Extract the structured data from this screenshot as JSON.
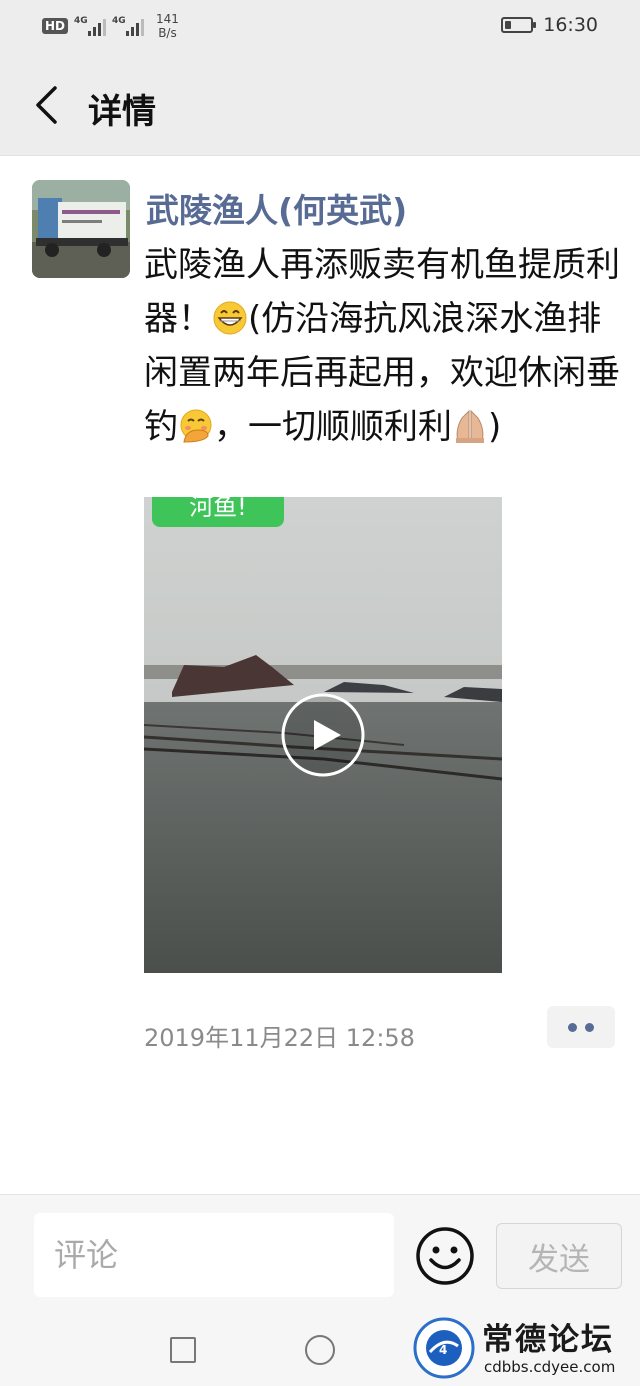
{
  "status_bar": {
    "hd": "HD",
    "sim1_network": "4G",
    "sim2_network": "4G",
    "speed_value": "141",
    "speed_unit": "B/s",
    "battery_level": 0.25,
    "time": "16:30"
  },
  "header": {
    "back_icon": "chevron-left-icon",
    "title": "详情"
  },
  "post": {
    "author": "武陵渔人(何英武)",
    "text_1": "武陵渔人再添贩卖有机鱼提质利器！",
    "emoji_1": "grinning-face-icon",
    "text_2": "(仿沿海抗风浪深水渔排闲置两年后再起用，欢迎休闲垂钓",
    "emoji_2": "face-with-hand-over-mouth-icon",
    "text_3": "，一切顺顺利利",
    "emoji_3": "folded-hands-icon",
    "text_4": ")",
    "video_overlay_text": "河鱼!",
    "play_icon": "play-icon",
    "timestamp": "2019年11月22日 12:58",
    "more_icon": "more-dots-icon"
  },
  "comment_bar": {
    "placeholder": "评论",
    "emoji_icon": "smiley-icon",
    "send_label": "发送"
  },
  "nav": {
    "recent_icon": "square-icon",
    "home_icon": "circle-icon"
  },
  "watermark": {
    "logo_text": "常德论坛",
    "url": "cdbbs.cdyee.com"
  },
  "colors": {
    "author_link": "#576b95",
    "header_bg": "#ededed",
    "timestamp": "#8a8a8a"
  }
}
